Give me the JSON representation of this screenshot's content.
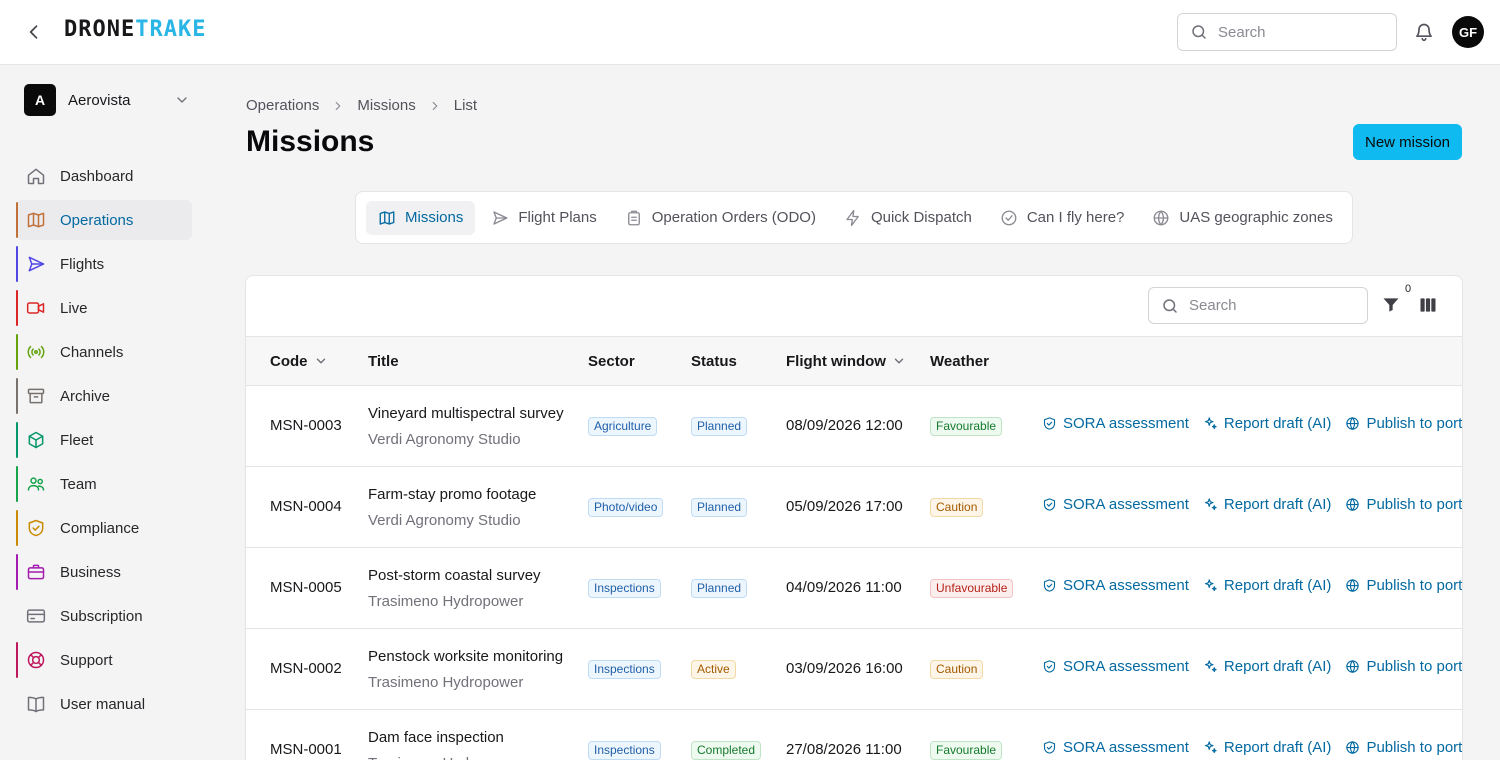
{
  "app": {
    "logo_part1": "DRONE",
    "logo_part2": "TRAKE",
    "search_placeholder": "Search",
    "user_initials": "GF"
  },
  "sidebar": {
    "org_initial": "A",
    "org_name": "Aerovista",
    "items": [
      {
        "label": "Dashboard",
        "icon": "home-icon",
        "accent": ""
      },
      {
        "label": "Operations",
        "icon": "map-icon",
        "accent": "#c2703a",
        "active": true
      },
      {
        "label": "Flights",
        "icon": "send-icon",
        "accent": "#4f46e5"
      },
      {
        "label": "Live",
        "icon": "video-icon",
        "accent": "#dc2626"
      },
      {
        "label": "Channels",
        "icon": "broadcast-icon",
        "accent": "#65a30d"
      },
      {
        "label": "Archive",
        "icon": "archive-icon",
        "accent": "#78716c"
      },
      {
        "label": "Fleet",
        "icon": "cube-icon",
        "accent": "#059669"
      },
      {
        "label": "Team",
        "icon": "users-icon",
        "accent": "#16a34a"
      },
      {
        "label": "Compliance",
        "icon": "shield-icon",
        "accent": "#ca8a04"
      },
      {
        "label": "Business",
        "icon": "briefcase-icon",
        "accent": "#a21caf"
      },
      {
        "label": "Subscription",
        "icon": "credit-card-icon",
        "accent": ""
      },
      {
        "label": "Support",
        "icon": "lifebuoy-icon",
        "accent": "#be185d"
      },
      {
        "label": "User manual",
        "icon": "book-icon",
        "accent": ""
      }
    ]
  },
  "breadcrumb": [
    "Operations",
    "Missions",
    "List"
  ],
  "page": {
    "title": "Missions",
    "new_button": "New mission"
  },
  "tabs": [
    {
      "label": "Missions",
      "icon": "map-icon",
      "active": true
    },
    {
      "label": "Flight Plans",
      "icon": "send-icon"
    },
    {
      "label": "Operation Orders (ODO)",
      "icon": "clipboard-icon"
    },
    {
      "label": "Quick Dispatch",
      "icon": "bolt-icon"
    },
    {
      "label": "Can I fly here?",
      "icon": "check-circle-icon"
    },
    {
      "label": "UAS geographic zones",
      "icon": "globe-icon"
    }
  ],
  "table": {
    "search_placeholder": "Search",
    "filter_count": "0",
    "columns": {
      "code": "Code",
      "title": "Title",
      "sector": "Sector",
      "status": "Status",
      "window": "Flight window",
      "weather": "Weather"
    },
    "actions": {
      "sora": "SORA assessment",
      "report": "Report draft (AI)",
      "publish": "Publish to portfolio"
    },
    "rows": [
      {
        "code": "MSN-0003",
        "title": "Vineyard multispectral survey",
        "client": "Verdi Agronomy Studio",
        "sector": "Agriculture",
        "status": "Planned",
        "status_style": "b-blue",
        "window": "08/09/2026 12:00",
        "weather": "Favourable",
        "weather_style": "b-green"
      },
      {
        "code": "MSN-0004",
        "title": "Farm-stay promo footage",
        "client": "Verdi Agronomy Studio",
        "sector": "Photo/video",
        "status": "Planned",
        "status_style": "b-blue",
        "window": "05/09/2026 17:00",
        "weather": "Caution",
        "weather_style": "b-amber"
      },
      {
        "code": "MSN-0005",
        "title": "Post-storm coastal survey",
        "client": "Trasimeno Hydropower",
        "sector": "Inspections",
        "status": "Planned",
        "status_style": "b-blue",
        "window": "04/09/2026 11:00",
        "weather": "Unfavourable",
        "weather_style": "b-red"
      },
      {
        "code": "MSN-0002",
        "title": "Penstock worksite monitoring",
        "client": "Trasimeno Hydropower",
        "sector": "Inspections",
        "status": "Active",
        "status_style": "b-amber",
        "window": "03/09/2026 16:00",
        "weather": "Caution",
        "weather_style": "b-amber"
      },
      {
        "code": "MSN-0001",
        "title": "Dam face inspection",
        "client": "Trasimeno Hydropower",
        "sector": "Inspections",
        "status": "Completed",
        "status_style": "b-green",
        "window": "27/08/2026 11:00",
        "weather": "Favourable",
        "weather_style": "b-green"
      }
    ]
  }
}
